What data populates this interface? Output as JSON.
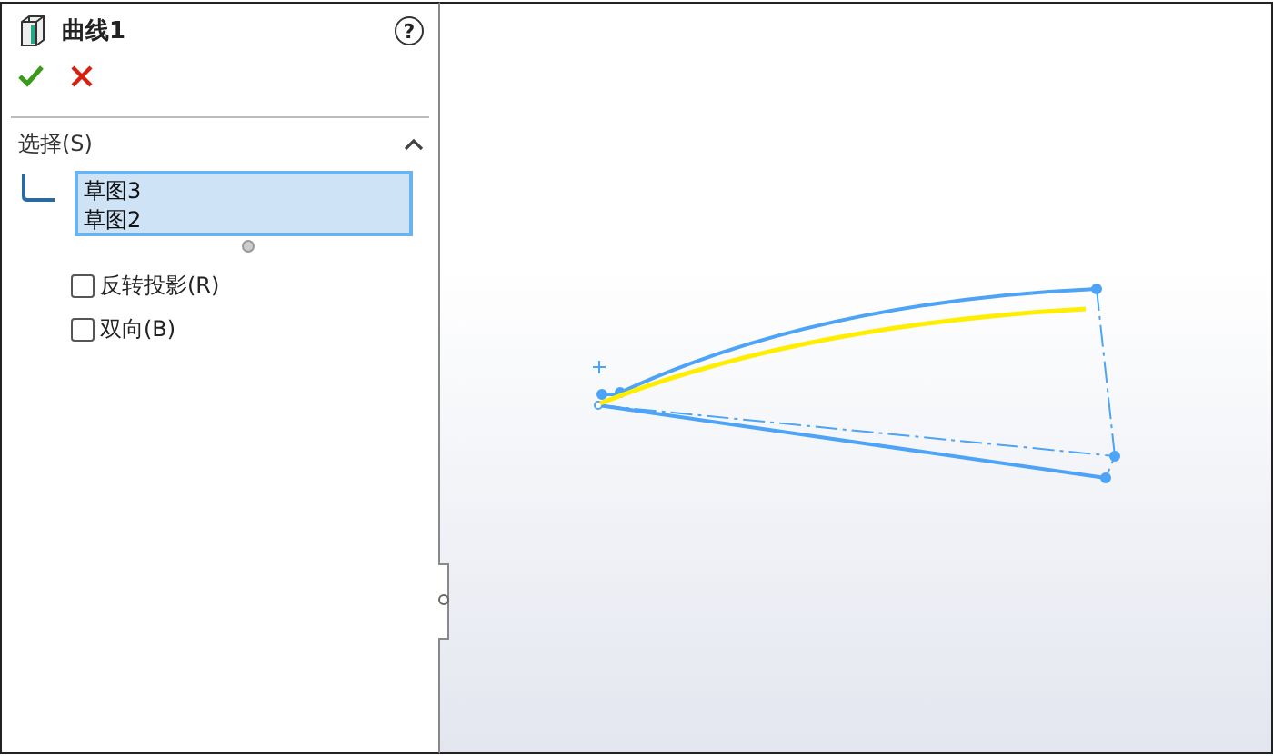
{
  "panel": {
    "title": "曲线1",
    "help": "?"
  },
  "section": {
    "title": "选择(S)",
    "expanded": true,
    "selection_list": [
      "草图3",
      "草图2"
    ],
    "options": [
      {
        "label": "反转投影(R)",
        "checked": false
      },
      {
        "label": "双向(B)",
        "checked": false
      }
    ]
  }
}
